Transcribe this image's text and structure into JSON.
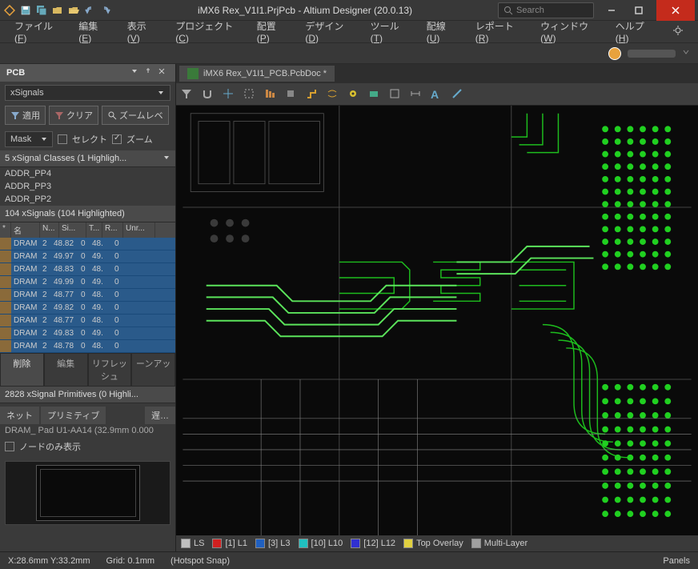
{
  "title": "iMX6 Rex_V1I1.PrjPcb - Altium Designer (20.0.13)",
  "search_placeholder": "Search",
  "menus": [
    {
      "label": "ファイル",
      "accel": "F"
    },
    {
      "label": "編集",
      "accel": "E"
    },
    {
      "label": "表示",
      "accel": "V"
    },
    {
      "label": "プロジェクト",
      "accel": "C"
    },
    {
      "label": "配置",
      "accel": "P"
    },
    {
      "label": "デザイン",
      "accel": "D"
    },
    {
      "label": "ツール",
      "accel": "T"
    },
    {
      "label": "配線",
      "accel": "U"
    },
    {
      "label": "レポート",
      "accel": "R"
    },
    {
      "label": "ウィンドウ",
      "accel": "W"
    },
    {
      "label": "ヘルプ",
      "accel": "H"
    }
  ],
  "panel": {
    "title": "PCB",
    "dropdown": "xSignals",
    "apply": "適用",
    "clear": "クリア",
    "zoom": "ズームレベ",
    "mask": "Mask",
    "cb_select": "セレクト",
    "cb_zoom": "ズーム",
    "classes_header": "5 xSignal Classes (1 Highligh...",
    "class_items": [
      "ADDR_PP4",
      "ADDR_PP3",
      "ADDR_PP2"
    ],
    "signals_header": "104 xSignals (104 Highlighted)",
    "sig_cols": [
      "*",
      "名",
      "N...",
      "Si...",
      "T...",
      "R...",
      "Unr..."
    ],
    "sig_rows": [
      {
        "name": "DRAM",
        "a": "2",
        "b": "48.82",
        "c": "0",
        "d": "48.",
        "e": "0"
      },
      {
        "name": "DRAM",
        "a": "2",
        "b": "49.97",
        "c": "0",
        "d": "49.",
        "e": "0"
      },
      {
        "name": "DRAM",
        "a": "2",
        "b": "48.83",
        "c": "0",
        "d": "48.",
        "e": "0"
      },
      {
        "name": "DRAM",
        "a": "2",
        "b": "49.99",
        "c": "0",
        "d": "49.",
        "e": "0"
      },
      {
        "name": "DRAM",
        "a": "2",
        "b": "48.77",
        "c": "0",
        "d": "48.",
        "e": "0"
      },
      {
        "name": "DRAM",
        "a": "2",
        "b": "49.82",
        "c": "0",
        "d": "49.",
        "e": "0"
      },
      {
        "name": "DRAM",
        "a": "2",
        "b": "48.77",
        "c": "0",
        "d": "48.",
        "e": "0"
      },
      {
        "name": "DRAM",
        "a": "2",
        "b": "49.83",
        "c": "0",
        "d": "49.",
        "e": "0"
      },
      {
        "name": "DRAM",
        "a": "2",
        "b": "48.78",
        "c": "0",
        "d": "48.",
        "e": "0"
      }
    ],
    "actions": {
      "delete": "削除",
      "edit": "編集",
      "refresh": "リフレッシュ",
      "clean": "ーンアッ"
    },
    "prim_header": "2828 xSignal Primitives (0 Highli...",
    "prim_tab_net": "ネット",
    "prim_tab_prim": "プリミティブ",
    "prim_tab_delay": "遅…",
    "prim_info": "DRAM_ Pad U1-AA14 (32.9mm 0.000",
    "cb_nodeonly": "ノードのみ表示"
  },
  "doc_tab": "iMX6 Rex_V1I1_PCB.PcbDoc *",
  "layers": [
    {
      "name": "LS",
      "color": "#c0c0c0"
    },
    {
      "name": "[1] L1",
      "color": "#d02020"
    },
    {
      "name": "[3] L3",
      "color": "#2060c0"
    },
    {
      "name": "[10] L10",
      "color": "#20c0c0"
    },
    {
      "name": "[12] L12",
      "color": "#3030d0"
    },
    {
      "name": "Top Overlay",
      "color": "#e0d040"
    },
    {
      "name": "Multi-Layer",
      "color": "#a0a0a0"
    }
  ],
  "status": {
    "coord": "X:28.6mm Y:33.2mm",
    "grid": "Grid: 0.1mm",
    "snap": "(Hotspot Snap)",
    "panels": "Panels"
  }
}
